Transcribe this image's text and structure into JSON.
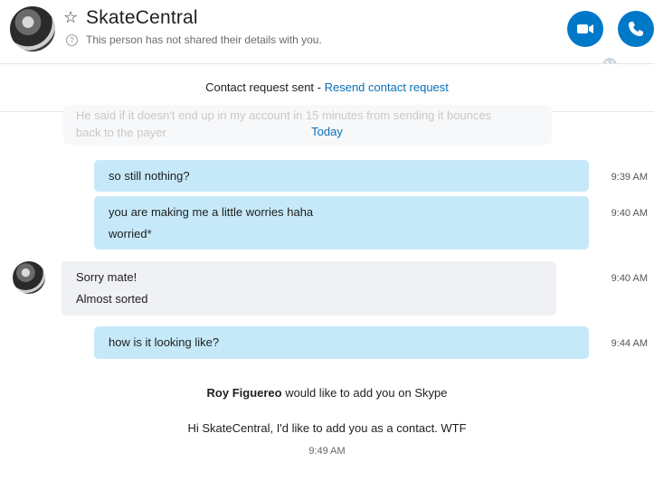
{
  "header": {
    "contact_name": "SkateCentral",
    "status": "This person has not shared their details with you."
  },
  "request_bar": {
    "text": "Contact request sent - ",
    "link": "Resend contact request"
  },
  "faded_message": {
    "line1": "He said if it doesn't end up in my account in 15 minutes from sending it bounces",
    "line2": "back to the payer"
  },
  "date_divider": "Today",
  "messages": [
    {
      "lines": [
        "so still nothing?"
      ],
      "time": "9:39 AM"
    },
    {
      "lines": [
        "you are making me a little worries haha",
        "worried*"
      ],
      "time": "9:40 AM"
    },
    {
      "lines": [
        "Sorry mate!",
        "Almost sorted"
      ],
      "time": "9:40 AM"
    },
    {
      "lines": [
        "how is it looking like?"
      ],
      "time": "9:44 AM"
    }
  ],
  "add_request": {
    "sender": "Roy Figuereo",
    "suffix": " would like to add you on Skype",
    "message": "Hi SkateCentral, I'd like to add you as a contact. WTF",
    "time": "9:49 AM"
  },
  "colors": {
    "accent": "#0078c8",
    "outgoing_bubble": "#c6e9f9",
    "incoming_bubble": "#eff1f5",
    "link": "#0a6fb6"
  }
}
